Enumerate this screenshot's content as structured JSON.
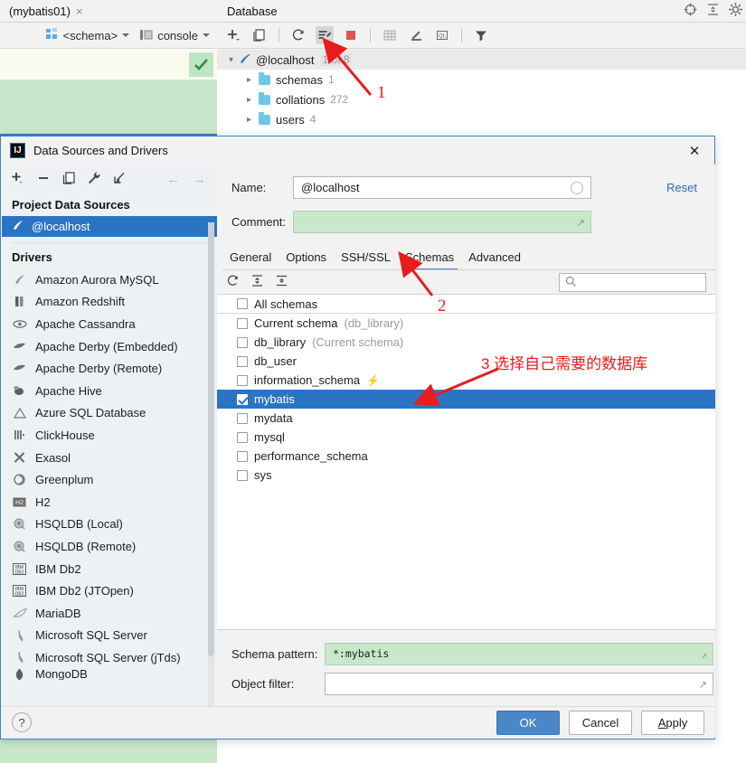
{
  "editor": {
    "tab_label": "(mybatis01)",
    "tab_close": "×",
    "schema_selector": "<schema>",
    "console_selector": "console"
  },
  "database_panel": {
    "title": "Database",
    "header_icons": [
      "locate-icon",
      "collapse-all-icon",
      "settings-gear-icon"
    ],
    "toolbar_icons": [
      "add-icon",
      "duplicate-icon",
      "refresh-icon",
      "run-configuration-icon",
      "stop-icon",
      "table-icon",
      "edit-icon",
      "query-console-icon",
      "filter-icon"
    ],
    "tree": [
      {
        "label": "@localhost",
        "count": "1 of 8",
        "icon": "datasource-icon",
        "depth": 0,
        "expanded": true
      },
      {
        "label": "schemas",
        "count": "1",
        "icon": "folder-icon",
        "depth": 1,
        "expanded": false
      },
      {
        "label": "collations",
        "count": "272",
        "icon": "folder-icon",
        "depth": 1,
        "expanded": false
      },
      {
        "label": "users",
        "count": "4",
        "icon": "folder-icon",
        "depth": 1,
        "expanded": false
      }
    ]
  },
  "dialog": {
    "title": "Data Sources and Drivers",
    "close_label": "✕",
    "left_pane": {
      "toolbar_icons": [
        "add-icon",
        "remove-icon",
        "duplicate-icon",
        "wrench-icon",
        "import-icon"
      ],
      "nav_back": "←",
      "nav_forward": "→",
      "project_section": "Project Data Sources",
      "data_sources": [
        {
          "label": "@localhost",
          "icon": "mysql-icon",
          "selected": true
        }
      ],
      "drivers_section": "Drivers",
      "drivers": [
        {
          "label": "Amazon Aurora MySQL",
          "icon": "mysql-dolphin-icon"
        },
        {
          "label": "Amazon Redshift",
          "icon": "redshift-icon"
        },
        {
          "label": "Apache Cassandra",
          "icon": "cassandra-eye-icon"
        },
        {
          "label": "Apache Derby (Embedded)",
          "icon": "derby-icon"
        },
        {
          "label": "Apache Derby (Remote)",
          "icon": "derby-icon"
        },
        {
          "label": "Apache Hive",
          "icon": "hive-bee-icon"
        },
        {
          "label": "Azure SQL Database",
          "icon": "azure-icon"
        },
        {
          "label": "ClickHouse",
          "icon": "clickhouse-icon"
        },
        {
          "label": "Exasol",
          "icon": "exasol-x-icon"
        },
        {
          "label": "Greenplum",
          "icon": "greenplum-icon"
        },
        {
          "label": "H2",
          "icon": "h2-icon"
        },
        {
          "label": "HSQLDB (Local)",
          "icon": "hsqldb-icon"
        },
        {
          "label": "HSQLDB (Remote)",
          "icon": "hsqldb-icon"
        },
        {
          "label": "IBM Db2",
          "icon": "ibm-db2-icon"
        },
        {
          "label": "IBM Db2 (JTOpen)",
          "icon": "ibm-db2-icon"
        },
        {
          "label": "MariaDB",
          "icon": "mariadb-seal-icon"
        },
        {
          "label": "Microsoft SQL Server",
          "icon": "mssql-icon"
        },
        {
          "label": "Microsoft SQL Server (jTds)",
          "icon": "mssql-icon"
        },
        {
          "label": "MongoDB",
          "icon": "mongodb-icon"
        }
      ]
    },
    "name_label": "Name:",
    "name_value": "@localhost",
    "comment_label": "Comment:",
    "comment_value": "",
    "reset_label": "Reset",
    "tabs": [
      {
        "label": "General",
        "active": false
      },
      {
        "label": "Options",
        "active": false
      },
      {
        "label": "SSH/SSL",
        "active": false
      },
      {
        "label": "Schemas",
        "active": true
      },
      {
        "label": "Advanced",
        "active": false
      }
    ],
    "schema_toolbar_icons": [
      "refresh-icon",
      "expand-all-icon",
      "collapse-all-icon"
    ],
    "search_placeholder": "",
    "search_value": "",
    "schemas": [
      {
        "label": "All schemas",
        "note": "",
        "checked": false,
        "selected": false,
        "bolt": false
      },
      {
        "label": "Current schema",
        "note": "(db_library)",
        "checked": false,
        "selected": false,
        "bolt": false
      },
      {
        "label": "db_library",
        "note": "(Current schema)",
        "checked": false,
        "selected": false,
        "bolt": false
      },
      {
        "label": "db_user",
        "note": "",
        "checked": false,
        "selected": false,
        "bolt": false
      },
      {
        "label": "information_schema",
        "note": "",
        "checked": false,
        "selected": false,
        "bolt": true
      },
      {
        "label": "mybatis",
        "note": "",
        "checked": true,
        "selected": true,
        "bolt": false
      },
      {
        "label": "mydata",
        "note": "",
        "checked": false,
        "selected": false,
        "bolt": false
      },
      {
        "label": "mysql",
        "note": "",
        "checked": false,
        "selected": false,
        "bolt": false
      },
      {
        "label": "performance_schema",
        "note": "",
        "checked": false,
        "selected": false,
        "bolt": false
      },
      {
        "label": "sys",
        "note": "",
        "checked": false,
        "selected": false,
        "bolt": false
      }
    ],
    "schema_pattern_label": "Schema pattern:",
    "schema_pattern_value": "*:mybatis",
    "object_filter_label": "Object filter:",
    "object_filter_value": "",
    "help_label": "?",
    "buttons": {
      "ok": "OK",
      "cancel": "Cancel",
      "apply_prefix": "A",
      "apply_rest": "pply"
    }
  },
  "annotations": [
    {
      "id": "anno-1",
      "text": "1"
    },
    {
      "id": "anno-2",
      "text": "2"
    },
    {
      "id": "anno-3",
      "text": "3 选择自己需要的数据库"
    }
  ],
  "colors": {
    "accent_blue": "#2b74c4",
    "dialog_border": "#3a86c8",
    "annotation_red": "#e81c1c",
    "editor_green": "#c9e7cb",
    "editor_cream": "#fbfaef"
  }
}
